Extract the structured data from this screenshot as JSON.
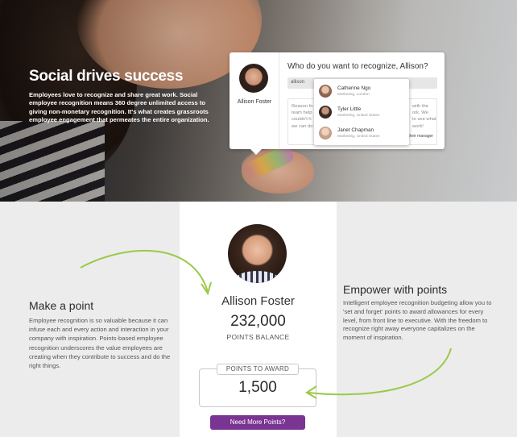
{
  "hero": {
    "title": "Social drives success",
    "text": "Employees love to recognize and share great work. Social employee recognition means 360 degree unlimited access to giving non-monetary recognition. It's what creates grassroots employee engagement that permeates the entire organization."
  },
  "recognize_card": {
    "user_name": "Allison Foster",
    "question": "Who do you want to recognize, Allison?",
    "search_value": "allison",
    "reason_left": "Reason fo\nteam help\ncouldn't h\nwe can do",
    "reason_right": "with the\nork. We\nto see what\nwork!",
    "manager_text": "their manager",
    "suggestions": [
      {
        "name": "Catherine Ngo",
        "location": "Marketing, London",
        "avatar_color": "#c9a08a"
      },
      {
        "name": "Tyler Little",
        "location": "Marketing, United States",
        "avatar_color": "#5c4a40"
      },
      {
        "name": "Janet Chapman",
        "location": "Marketing, United States",
        "avatar_color": "#d9b9a1"
      }
    ]
  },
  "profile": {
    "name": "Allison Foster",
    "points": "232,000",
    "points_label": "POINTS BALANCE"
  },
  "award": {
    "label": "POINTS TO AWARD",
    "value": "1,500",
    "button": "Need More Points?"
  },
  "left_section": {
    "title": "Make a point",
    "text": "Employee recognition is so valuable because it can infuse each and every action and interaction in your company with inspiration. Points-based employee recognition underscores the value employees are creating when they contribute to success and do the right things."
  },
  "right_section": {
    "title": "Empower with points",
    "text": "Intelligent employee recognition budgeting allow you to 'set and forget' points to award allowances for every level, from front line to executive. With the freedom to recognize right away everyone capitalizes on the moment of inspiration."
  },
  "colors": {
    "accent_purple": "#7a3491",
    "arrow_green": "#9bc94a"
  }
}
